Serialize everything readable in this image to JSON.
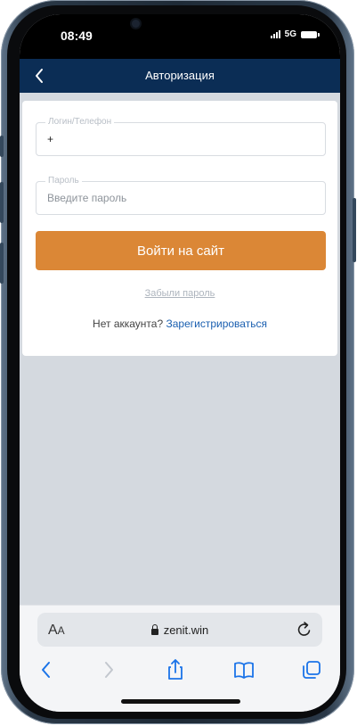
{
  "status_bar": {
    "time": "08:49",
    "network": "5G"
  },
  "navbar": {
    "title": "Авторизация",
    "back_icon": "chevron-left-icon"
  },
  "form": {
    "login_label": "Логин/Телефон",
    "login_value": "+",
    "password_label": "Пароль",
    "password_placeholder": "Введите пароль",
    "submit_label": "Войти на сайт",
    "forgot_label": "Забыли пароль",
    "no_account_text": "Нет аккаунта?",
    "register_label": "Зарегистрироваться"
  },
  "browser": {
    "text_size_label_big": "A",
    "text_size_label_small": "A",
    "url": "zenit.win",
    "toolbar_icons": [
      "back-icon",
      "forward-icon",
      "share-icon",
      "bookmarks-icon",
      "tabs-icon"
    ]
  },
  "colors": {
    "navbar": "#0b2d55",
    "primary_button": "#db8736",
    "link": "#1a5fb0",
    "page_background": "#d4d9df"
  }
}
